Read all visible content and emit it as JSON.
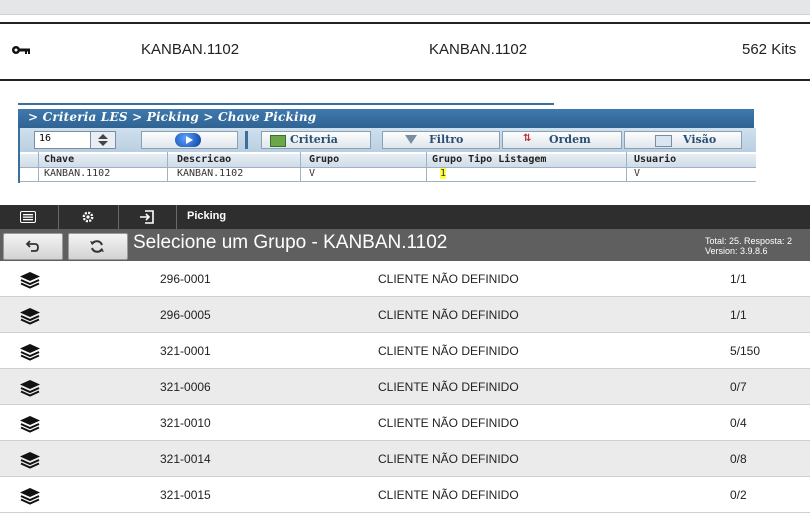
{
  "key_row": {
    "chave": "KANBAN.1102",
    "descricao": "KANBAN.1102",
    "kits": "562 Kits",
    "icon": "key-icon"
  },
  "criteria": {
    "breadcrumb": "> Criteria LES > Picking > Chave Picking",
    "page_size": "16",
    "buttons": {
      "criteria": "Criteria",
      "filtro": "Filtro",
      "ordem": "Ordem",
      "visao": "Visão"
    },
    "columns": [
      "Chave",
      "Descricao",
      "Grupo",
      "Grupo Tipo Listagem",
      "Usuario"
    ],
    "row": {
      "chave": "KANBAN.1102",
      "descricao": "KANBAN.1102",
      "grupo": "V",
      "grupo_tipo": "1",
      "usuario": "V"
    }
  },
  "picking": {
    "nav_title": "Picking",
    "heading": "Selecione um Grupo - KANBAN.1102",
    "meta_line1": "Total: 25. Resposta: 2",
    "meta_line2": "Version: 3.9.8.6",
    "rows": [
      {
        "grupo": "296-0001",
        "cliente": "CLIENTE NÃO DEFINIDO",
        "qtd": "1/1"
      },
      {
        "grupo": "296-0005",
        "cliente": "CLIENTE NÃO DEFINIDO",
        "qtd": "1/1"
      },
      {
        "grupo": "321-0001",
        "cliente": "CLIENTE NÃO DEFINIDO",
        "qtd": "5/150"
      },
      {
        "grupo": "321-0006",
        "cliente": "CLIENTE NÃO DEFINIDO",
        "qtd": "0/7"
      },
      {
        "grupo": "321-0010",
        "cliente": "CLIENTE NÃO DEFINIDO",
        "qtd": "0/4"
      },
      {
        "grupo": "321-0014",
        "cliente": "CLIENTE NÃO DEFINIDO",
        "qtd": "0/8"
      },
      {
        "grupo": "321-0015",
        "cliente": "CLIENTE NÃO DEFINIDO",
        "qtd": "0/2"
      }
    ]
  }
}
